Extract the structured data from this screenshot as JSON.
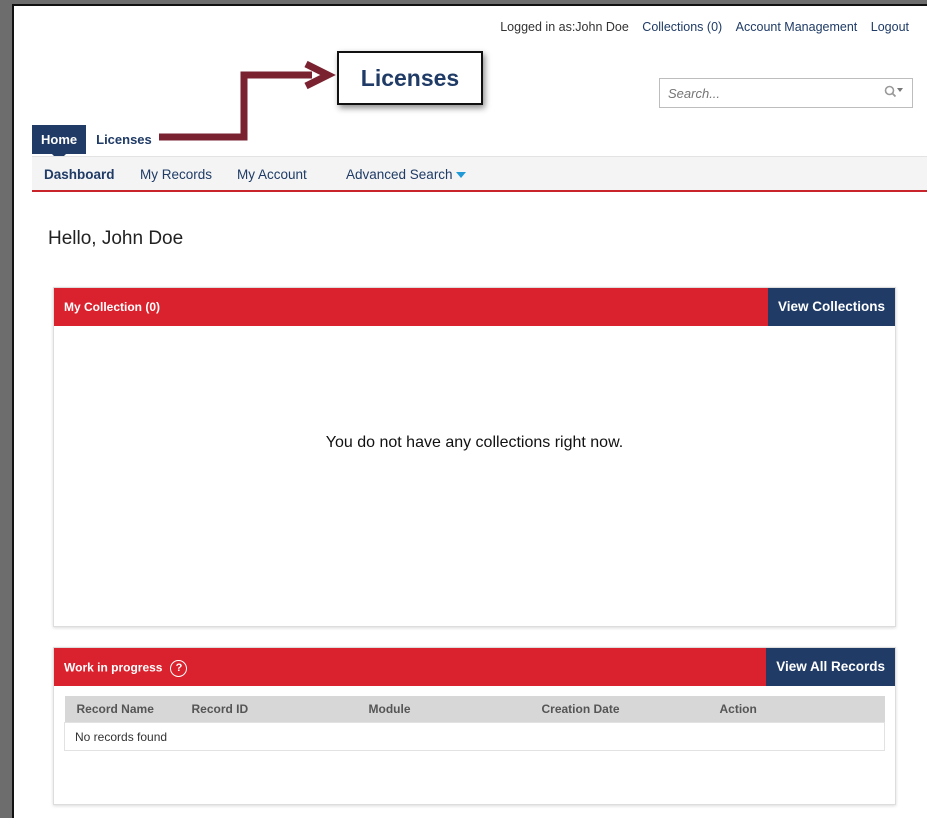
{
  "header": {
    "logged_in_text": "Logged in as:John Doe",
    "links": [
      "Collections (0)",
      "Account Management",
      "Logout"
    ]
  },
  "callout": {
    "label": "Licenses"
  },
  "search": {
    "placeholder": "Search..."
  },
  "tabs": [
    {
      "label": "Home",
      "active": true
    },
    {
      "label": "Licenses",
      "active": false
    }
  ],
  "subnav": {
    "items": [
      "Dashboard",
      "My Records",
      "My Account",
      "Advanced Search"
    ],
    "active": "Dashboard"
  },
  "greeting": "Hello, John Doe",
  "collection_panel": {
    "title": "My Collection (0)",
    "button": "View Collections",
    "empty_message": "You do not have any collections right now."
  },
  "work_panel": {
    "title": "Work in progress",
    "help_glyph": "?",
    "button": "View All Records",
    "columns": [
      "Record Name",
      "Record ID",
      "Module",
      "Creation Date",
      "Action"
    ],
    "empty_row": "No records found"
  },
  "colors": {
    "navy": "#1f3b66",
    "red": "#d9222d",
    "arrow": "#7a2230",
    "caret": "#1f9ad6"
  }
}
